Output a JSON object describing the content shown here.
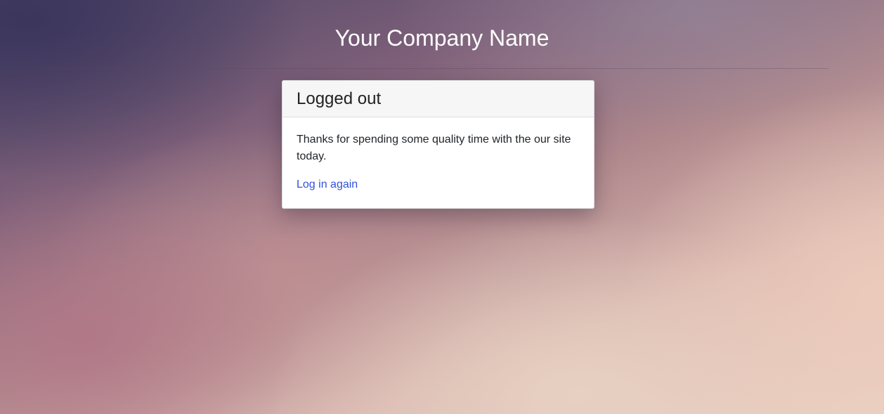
{
  "header": {
    "site_title": "Your Company Name"
  },
  "card": {
    "title": "Logged out",
    "message": "Thanks for spending some quality time with the our site today.",
    "link_label": "Log in again"
  },
  "colors": {
    "link": "#2f52d9",
    "title_text": "#ffffff",
    "card_header_bg": "#f6f6f6"
  }
}
